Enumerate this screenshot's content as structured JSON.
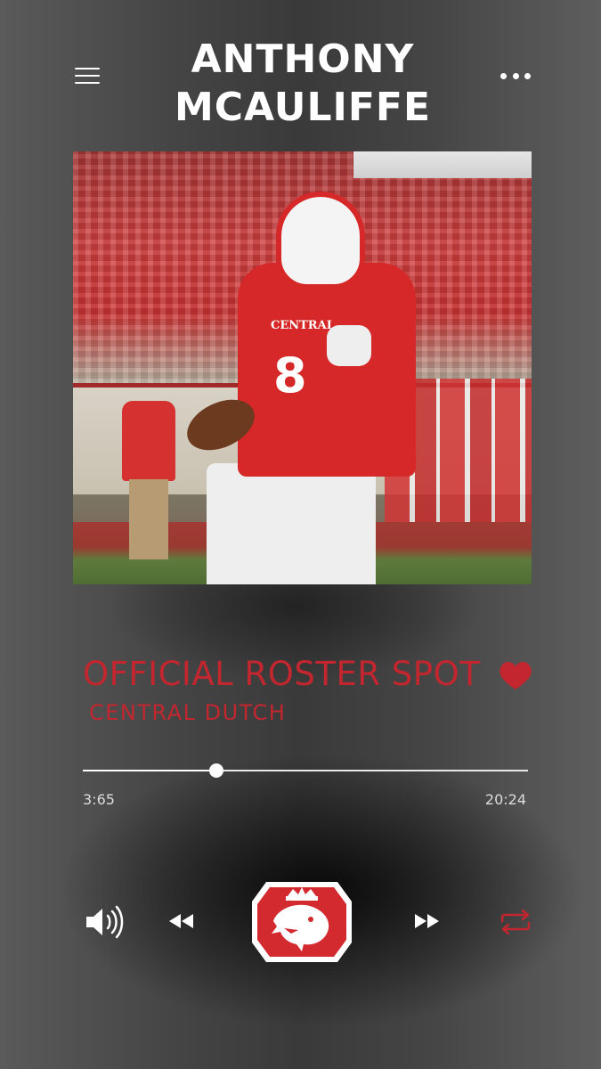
{
  "header": {
    "title_line1": "ANTHONY",
    "title_line2": "MCAULIFFE",
    "menu_icon": "hamburger-menu-icon",
    "more_icon": "more-options-icon"
  },
  "album_art": {
    "jersey_number": "8",
    "jersey_text": "CENTRAL"
  },
  "track": {
    "title": "OFFICIAL ROSTER SPOT",
    "subtitle": "CENTRAL DUTCH",
    "favorite_icon": "heart-icon",
    "accent_color": "#c3262e"
  },
  "progress": {
    "elapsed": "3:65",
    "total": "20:24",
    "fraction": 0.3
  },
  "controls": {
    "volume_icon": "volume-icon",
    "rewind_icon": "rewind-icon",
    "center_icon": "central-dutch-logo-icon",
    "forward_icon": "fast-forward-icon",
    "repeat_icon": "repeat-icon"
  }
}
